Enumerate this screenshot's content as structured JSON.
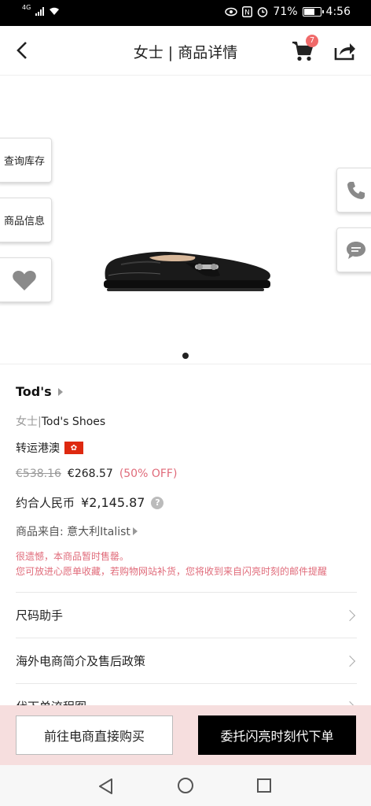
{
  "status": {
    "network": "4G",
    "battery_percent": "71%",
    "time": "4:56",
    "battery_level": 0.71
  },
  "header": {
    "title": "女士 | 商品详情",
    "cart_count": "7"
  },
  "hero": {
    "side_buttons": {
      "stock": "查询库存",
      "info": "商品信息"
    },
    "page_index": 1,
    "page_total": 1
  },
  "product": {
    "brand": "Tod's",
    "category_prefix": "女士|",
    "category_name": "Tod's Shoes",
    "shipping": "转运港澳",
    "original_price": "€538.16",
    "price": "€268.57",
    "discount": "(50% OFF)",
    "rmb_label": "约合人民币",
    "rmb_amount": "¥2,145.87",
    "source": "商品来自: 意大利Italist",
    "notice_line1": "很遗憾，本商品暂时售罄。",
    "notice_line2": "您可放进心愿单收藏，若购物网站补货，您将收到来自闪亮时刻的邮件提醒"
  },
  "rows": {
    "size_helper": "尺码助手",
    "policy": "海外电商简介及售后政策",
    "flow": "代下单流程图"
  },
  "actions": {
    "buy_direct": "前往电商直接购买",
    "proxy_order": "委托闪亮时刻代下单"
  },
  "colors": {
    "accent": "#e06b7a",
    "action_bar_bg": "#f6dede",
    "badge": "#f06a6a"
  }
}
